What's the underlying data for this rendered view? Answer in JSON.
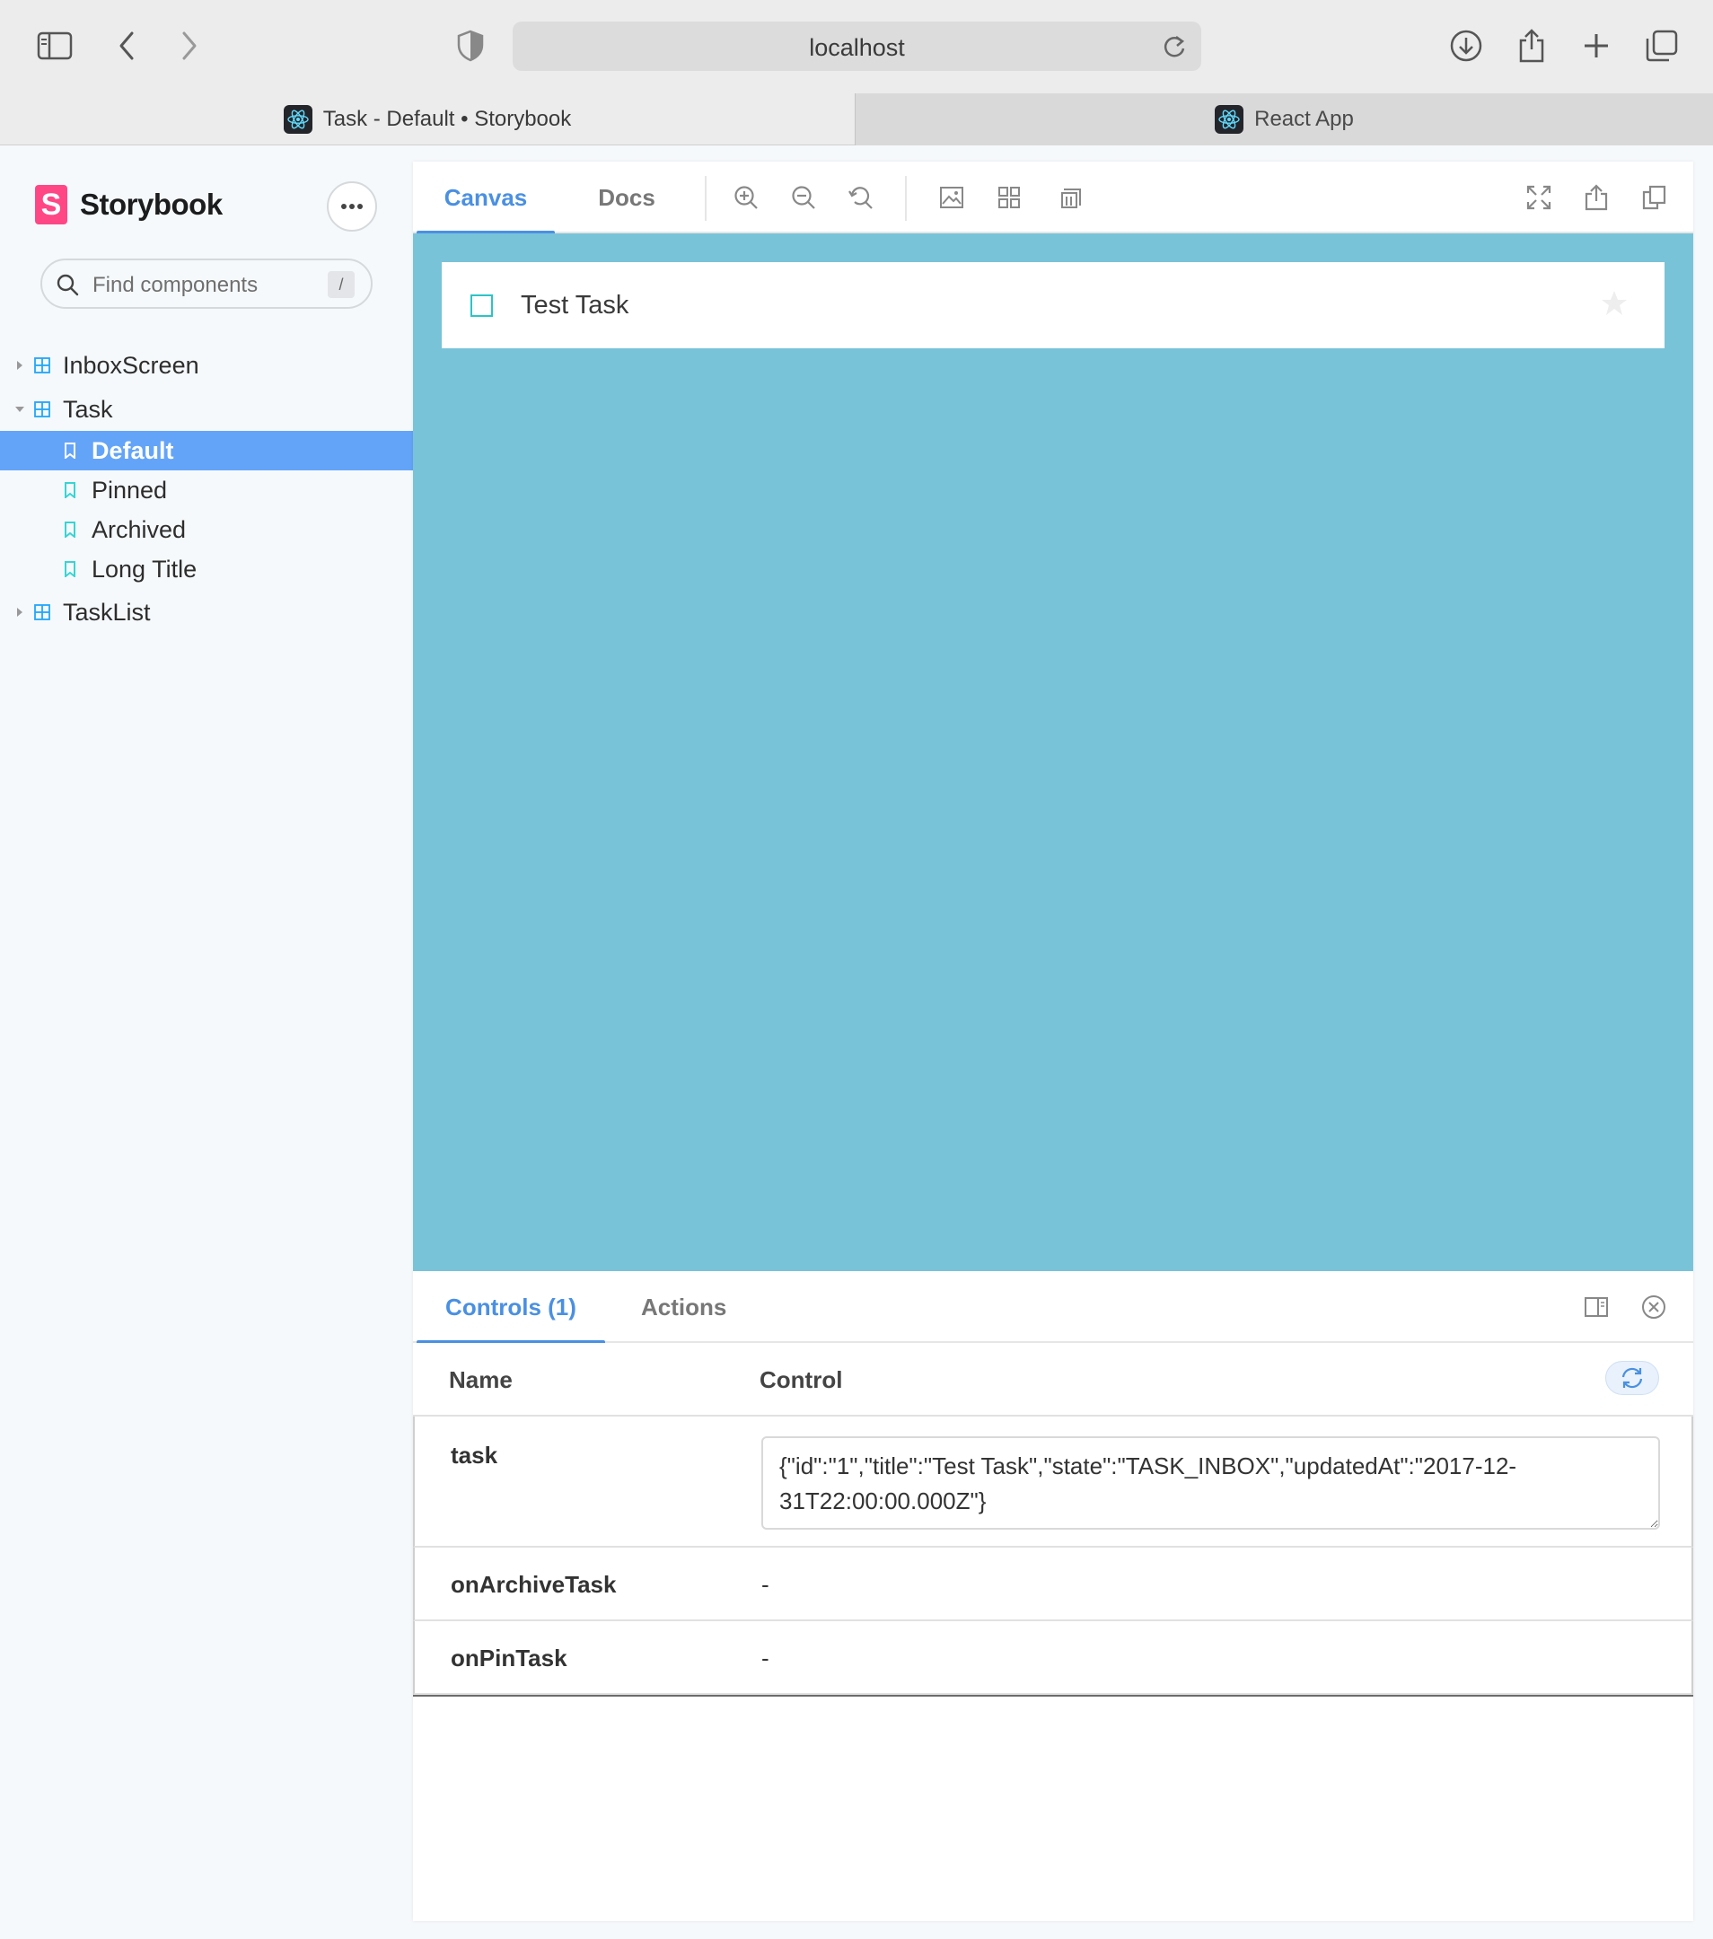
{
  "browser": {
    "url": "localhost",
    "tabs": [
      {
        "label": "Task - Default • Storybook",
        "active": true
      },
      {
        "label": "React App",
        "active": false
      }
    ]
  },
  "sidebar": {
    "brand": "Storybook",
    "logo_letter": "S",
    "search_placeholder": "Find components",
    "search_shortcut": "/",
    "tree": [
      {
        "label": "InboxScreen",
        "type": "component",
        "expanded": false
      },
      {
        "label": "Task",
        "type": "component",
        "expanded": true
      },
      {
        "label": "Default",
        "type": "story",
        "selected": true
      },
      {
        "label": "Pinned",
        "type": "story"
      },
      {
        "label": "Archived",
        "type": "story"
      },
      {
        "label": "Long Title",
        "type": "story"
      },
      {
        "label": "TaskList",
        "type": "component",
        "expanded": false
      }
    ]
  },
  "toolbar": {
    "tabs": [
      "Canvas",
      "Docs"
    ],
    "active_tab": "Canvas"
  },
  "canvas": {
    "background": "#79c3d8",
    "task_title": "Test Task"
  },
  "addons": {
    "tabs": [
      "Controls (1)",
      "Actions"
    ],
    "active_tab": "Controls (1)",
    "headers": {
      "name": "Name",
      "control": "Control"
    },
    "rows": [
      {
        "name": "task",
        "value": "{\"id\":\"1\",\"title\":\"Test Task\",\"state\":\"TASK_INBOX\",\"updatedAt\":\"2017-12-31T22:00:00.000Z\"}"
      },
      {
        "name": "onArchiveTask",
        "value": "-"
      },
      {
        "name": "onPinTask",
        "value": "-"
      }
    ]
  },
  "colors": {
    "accent": "#4a90e2",
    "selected_row": "#63a4f8",
    "brand": "#ff4785"
  }
}
